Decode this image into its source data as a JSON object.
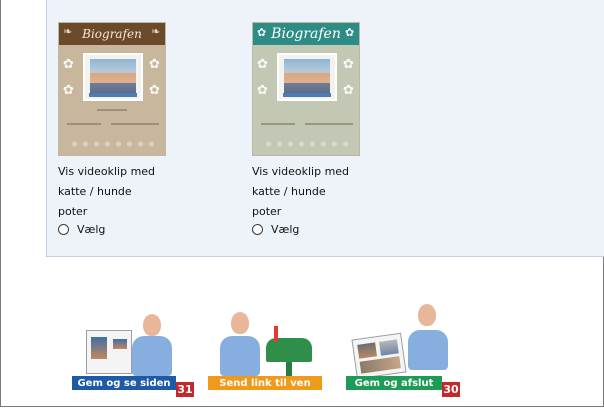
{
  "templates": [
    {
      "thumb_title": "Biografen",
      "caption_lines": [
        "Vis videoklip med",
        "katte / hunde",
        "poter"
      ],
      "radio_label": "Vælg"
    },
    {
      "thumb_title": "Biografen",
      "caption_lines": [
        "Vis videoklip med",
        "katte / hunde",
        "poter"
      ],
      "radio_label": "Vælg"
    }
  ],
  "actions": [
    {
      "label": "Gem og se siden",
      "badge": "31",
      "color": "#1f5aa6"
    },
    {
      "label": "Send link til ven",
      "badge": "",
      "color": "#f09a1b"
    },
    {
      "label": "Gem og afslut",
      "badge": "30",
      "color": "#1e9b57"
    }
  ],
  "colors": {
    "panel_bg": "#eef3f9",
    "badge_bg": "#c2282c"
  },
  "icons": [
    "paw-print-icon",
    "radio-button-icon"
  ]
}
